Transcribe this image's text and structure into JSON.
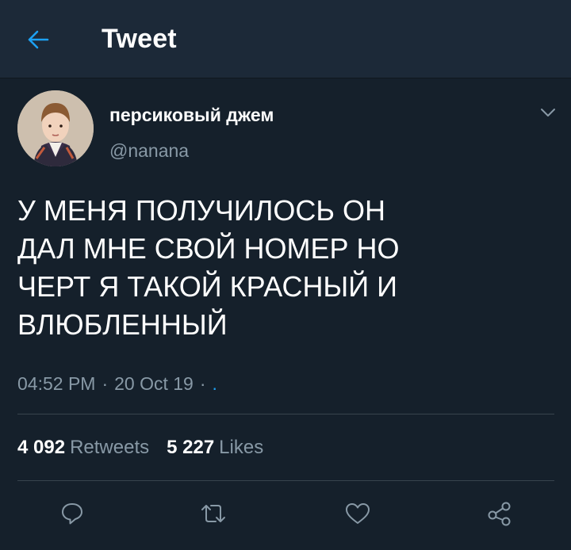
{
  "header": {
    "title": "Tweet",
    "back_icon": "arrow-left-icon",
    "accent": "#1da1f2"
  },
  "tweet": {
    "author": {
      "display_name": "персиковый джем",
      "handle": "@nanana",
      "avatar": "profile-photo"
    },
    "text": "У МЕНЯ ПОЛУЧИЛОСЬ ОН\nДАЛ МНЕ СВОЙ НОМЕР НО\nЧЕРТ Я ТАКОЙ КРАСНЫЙ И\nВЛЮБЛЕННЫЙ",
    "time": "04:52 PM",
    "date": "20 Oct 19",
    "source": ".",
    "retweets_count": "4 092",
    "retweets_label": "Retweets",
    "likes_count": "5 227",
    "likes_label": "Likes"
  },
  "actions": [
    "reply-icon",
    "retweet-icon",
    "like-icon",
    "share-icon"
  ],
  "colors": {
    "background": "#15202b",
    "header_bg": "#1c2938",
    "secondary_text": "#8899a6",
    "divider": "#38444d"
  }
}
